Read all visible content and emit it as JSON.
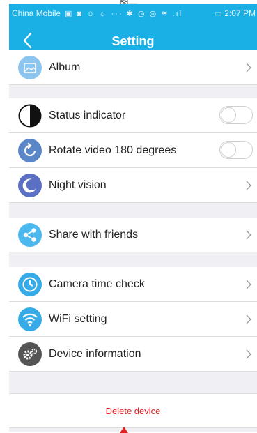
{
  "caption": "图二",
  "status_bar": {
    "carrier": "China Mobile",
    "icons": "▣ ◙ ☺ ☼ ··· ✱ ◷ ◎ ≋ .ıl",
    "battery_time": "▭ 2:07 PM"
  },
  "header": {
    "title": "Setting",
    "back_icon": "chevron-left-icon"
  },
  "rows": [
    {
      "label": "Album",
      "icon": "album-icon",
      "control": "chevron",
      "icon_color": "#8cc6f0"
    },
    {
      "label": "Status indicator",
      "icon": "status-indicator-icon",
      "control": "toggle",
      "state": "off"
    },
    {
      "label": "Rotate video 180 degrees",
      "icon": "rotate-icon",
      "control": "toggle",
      "state": "off",
      "icon_color": "#5b86c8"
    },
    {
      "label": "Night vision",
      "icon": "moon-icon",
      "control": "chevron",
      "icon_color": "#5b70c2"
    },
    {
      "label": "Share with friends",
      "icon": "share-icon",
      "control": "chevron",
      "icon_color": "#4bb8ee"
    },
    {
      "label": "Camera time check",
      "icon": "clock-icon",
      "control": "chevron",
      "icon_color": "#36abe8"
    },
    {
      "label": "WiFi setting",
      "icon": "wifi-icon",
      "control": "chevron",
      "icon_color": "#36abe8"
    },
    {
      "label": "Device information",
      "icon": "gear-icon",
      "control": "chevron",
      "icon_color": "#555555"
    }
  ],
  "delete_label": "Delete device",
  "colors": {
    "accent": "#1ab0e6",
    "danger": "#e02020",
    "background": "#efeff4"
  }
}
